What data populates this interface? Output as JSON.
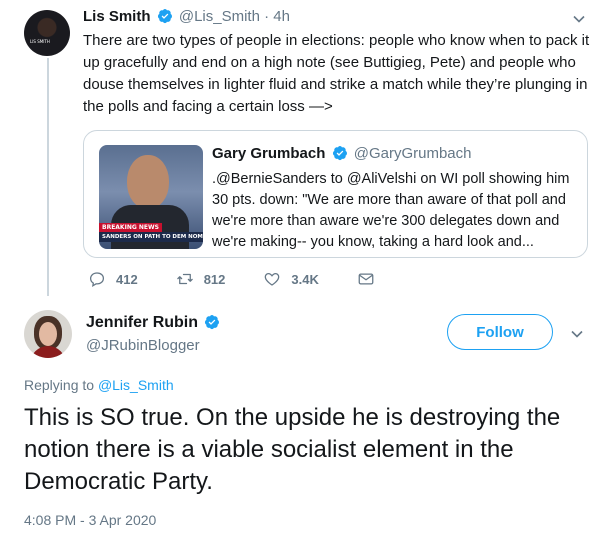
{
  "colors": {
    "accent": "#1da1f2",
    "text": "#14171a",
    "muted": "#657786",
    "border": "#ccd6dd",
    "verified": "#1da1f2"
  },
  "tweet1": {
    "name": "Lis Smith",
    "handle": "@Lis_Smith",
    "separator": "·",
    "time": "4h",
    "text": "There are two types of people in elections: people who know when to pack it up gracefully and end on a high note (see Buttigieg, Pete) and people who douse themselves in lighter fluid and strike a match while they’re plunging in the polls and facing a certain loss —>",
    "avatar_caption": "LIS SMITH",
    "quote": {
      "name": "Gary Grumbach",
      "handle": "@GaryGrumbach",
      "text": ".@BernieSanders to @AliVelshi on WI poll showing him 30 pts. down: \"We are more than aware of that poll and we're more than aware we're 300 delegates down and we're making-- you know, taking a hard look and...",
      "thumb_breaking": "BREAKING NEWS",
      "thumb_lower": "SANDERS ON PATH TO DEM NOM"
    },
    "actions": {
      "replies": "412",
      "retweets": "812",
      "likes": "3.4K"
    }
  },
  "tweet2": {
    "name": "Jennifer Rubin",
    "handle": "@JRubinBlogger",
    "follow_label": "Follow",
    "replying_prefix": "Replying to",
    "replying_to": "@Lis_Smith",
    "text": "This is SO true. On the upside he is destroying the notion there is a viable socialist element in the Democratic Party.",
    "timestamp": "4:08 PM - 3 Apr 2020"
  }
}
